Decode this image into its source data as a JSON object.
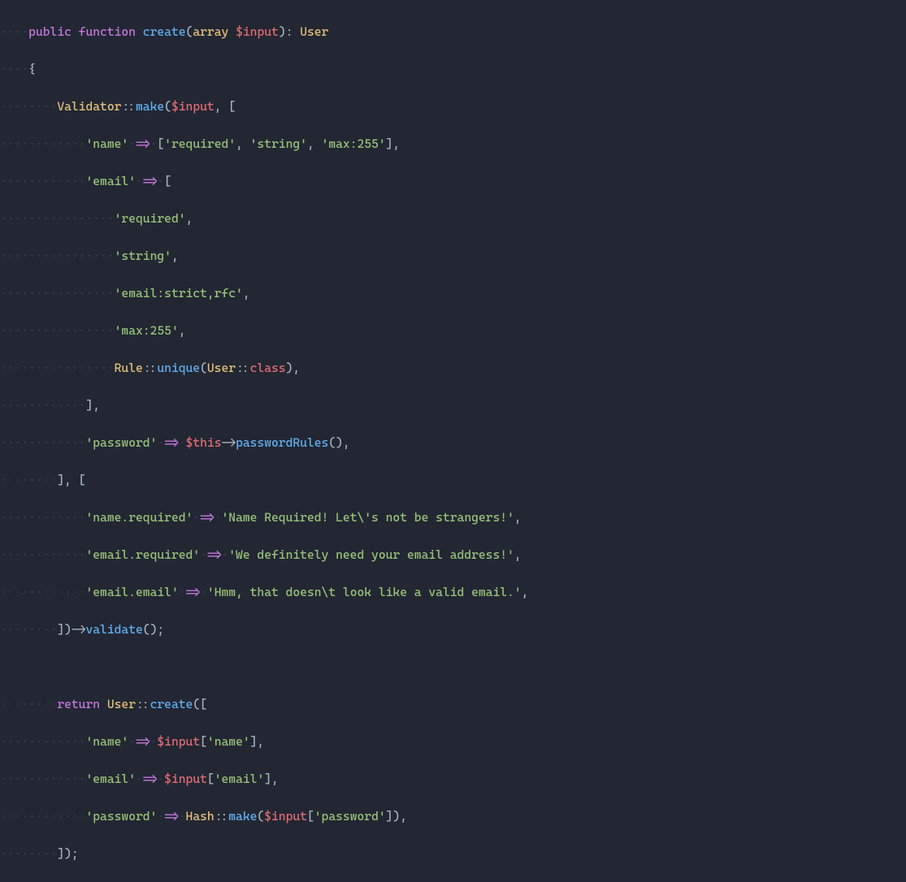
{
  "keywords": {
    "public": "public",
    "function": "function",
    "return": "return",
    "array": "array"
  },
  "symbols": {
    "User": "User",
    "Validator": "Validator",
    "Rule": "Rule",
    "Hash": "Hash"
  },
  "methods": {
    "create": "create",
    "make": "make",
    "unique": "unique",
    "passwordRules": "passwordRules",
    "validate": "validate"
  },
  "vars": {
    "input": "$input",
    "this": "$this",
    "class": "class"
  },
  "strings": {
    "name": "'name'",
    "email": "'email'",
    "password": "'password'",
    "required": "'required'",
    "string": "'string'",
    "max255": "'max:255'",
    "emailStrictRfc": "'email:strict,rfc'",
    "name_required_key": "'name.required'",
    "email_required_key": "'email.required'",
    "email_email_key": "'email.email'",
    "name_required_msg": "'Name Required! Let\\'s not be strangers!'",
    "email_required_msg": "'We definitely need your email address!'",
    "email_email_msg": "'Hmm, that doesn\\t look like a valid email.'",
    "idx_name": "'name'",
    "idx_email": "'email'",
    "idx_password": "'password'"
  },
  "indent": {
    "i1": "····",
    "i2": "········",
    "i3": "············",
    "i4": "················"
  },
  "chart_data": null
}
